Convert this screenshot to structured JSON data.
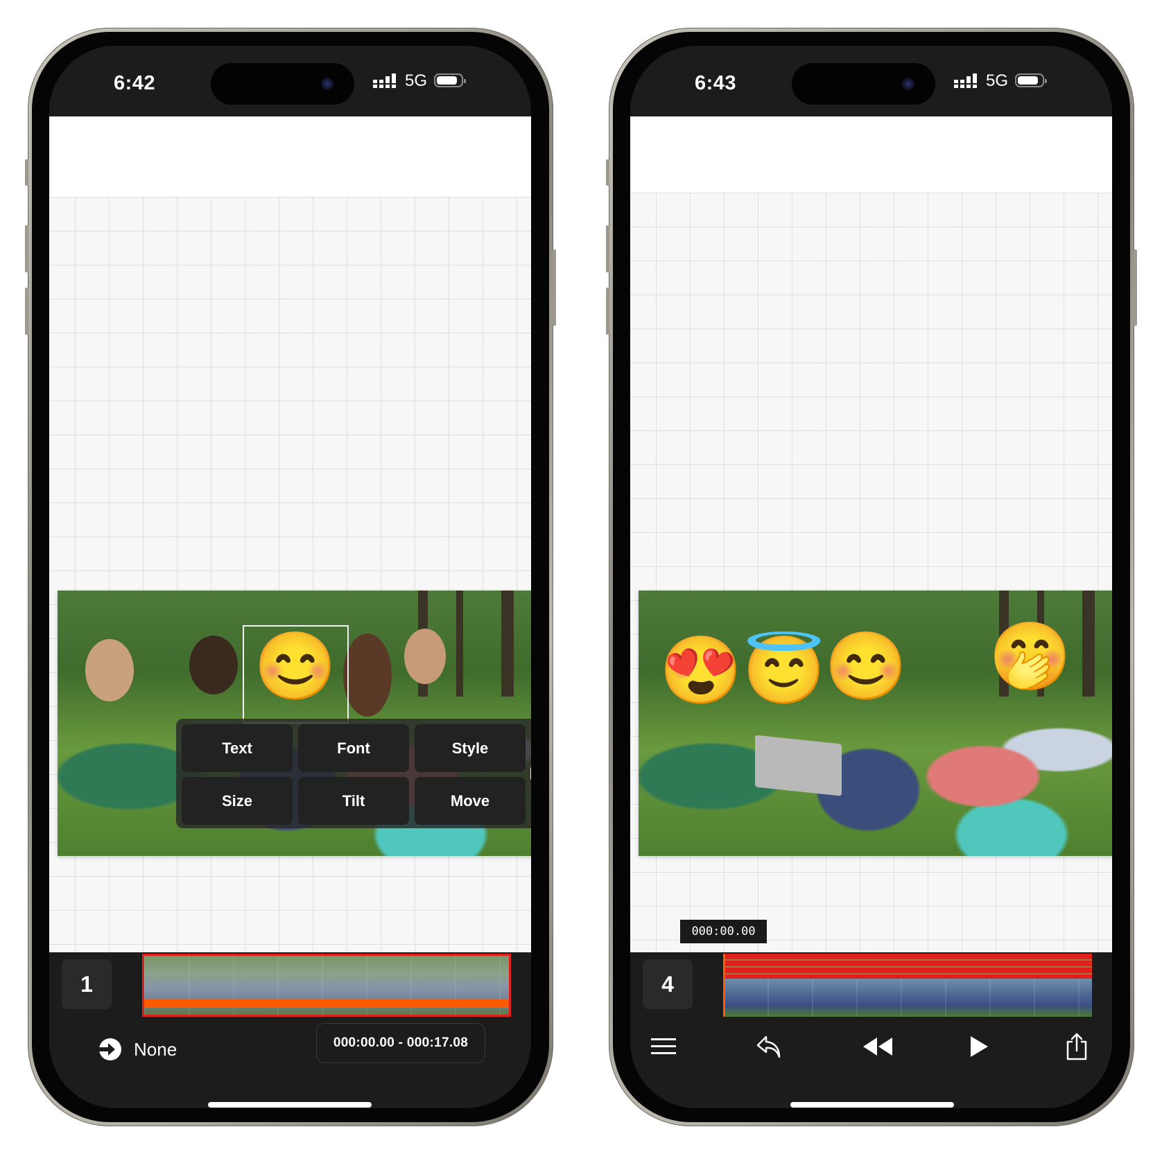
{
  "left_phone": {
    "status": {
      "time": "6:42",
      "network": "5G"
    },
    "video": {
      "overlays": [
        {
          "emoji": "😊",
          "name": "smiling-face-emoji",
          "selected": true
        }
      ]
    },
    "edit_menu": {
      "buttons": [
        {
          "label": "Text"
        },
        {
          "label": "Font"
        },
        {
          "label": "Style"
        },
        {
          "label": "Size"
        },
        {
          "label": "Tilt"
        },
        {
          "label": "Move"
        }
      ],
      "more_arrow": "chevron-right-icon"
    },
    "timeline": {
      "track_number": "1"
    },
    "bottom_bar": {
      "transition_icon": "arrow-circle-right-icon",
      "transition_label": "None",
      "time_range": "000:00.00 - 000:17.08"
    }
  },
  "right_phone": {
    "status": {
      "time": "6:43",
      "network": "5G"
    },
    "video": {
      "overlays": [
        {
          "emoji": "😍",
          "name": "heart-eyes-emoji"
        },
        {
          "emoji": "😇",
          "name": "halo-emoji"
        },
        {
          "emoji": "😊",
          "name": "smiling-face-emoji"
        },
        {
          "emoji": "🤭",
          "name": "hand-over-mouth-emoji"
        }
      ]
    },
    "playhead_time": "000:00.00",
    "timeline": {
      "track_number": "4"
    },
    "toolbar": [
      {
        "name": "menu-icon"
      },
      {
        "name": "undo-icon"
      },
      {
        "name": "rewind-icon"
      },
      {
        "name": "play-icon"
      },
      {
        "name": "share-icon"
      }
    ]
  },
  "colors": {
    "timeline_border": "#e0201c",
    "timeline_progress": "#ff5a00",
    "ui_dark": "#1c1c1c",
    "button_dark": "#222222"
  }
}
